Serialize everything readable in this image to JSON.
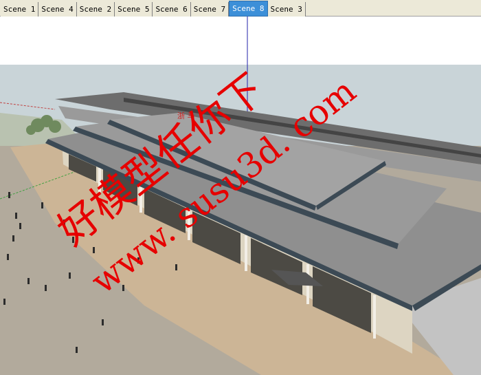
{
  "tabs": [
    {
      "label": "Scene 1",
      "active": false
    },
    {
      "label": "Scene 4",
      "active": false
    },
    {
      "label": "Scene 2",
      "active": false
    },
    {
      "label": "Scene 5",
      "active": false
    },
    {
      "label": "Scene 6",
      "active": false
    },
    {
      "label": "Scene 7",
      "active": false
    },
    {
      "label": "Scene 8",
      "active": true
    },
    {
      "label": "Scene 3",
      "active": false
    }
  ],
  "watermark": {
    "line1": "好模型任你下",
    "line2": "www. susu3d. com",
    "color": "#e60000"
  },
  "building_sign": "浙 马",
  "colors": {
    "sky": "#c9d4d8",
    "ground": "#b2aa9c",
    "plaza": "#ccb596",
    "roof": "#8a8a8a",
    "tab_active": "#3c8fd8"
  }
}
